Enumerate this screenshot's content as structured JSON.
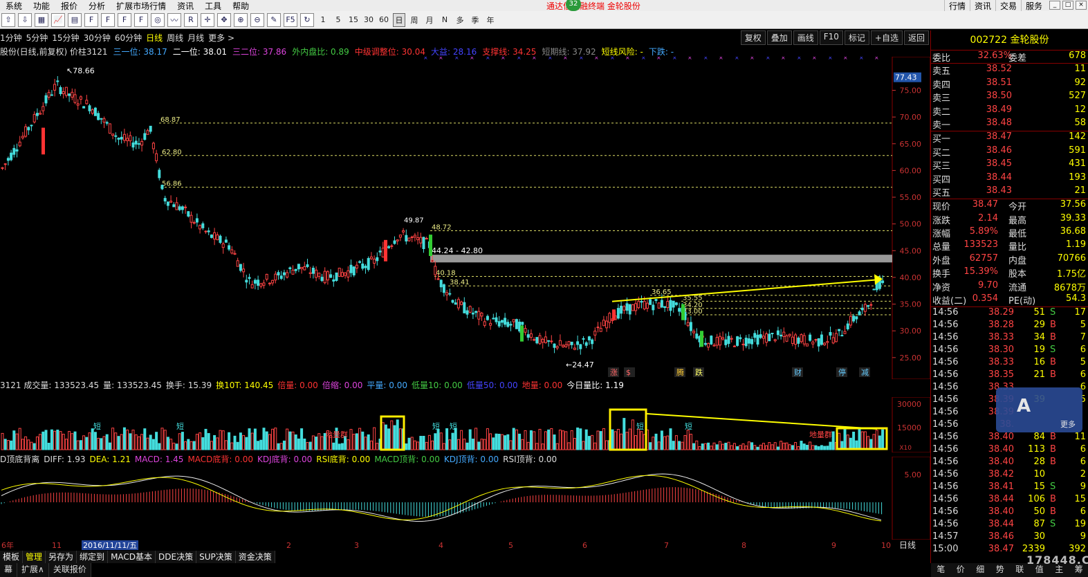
{
  "menubar": {
    "items": [
      "系统",
      "功能",
      "报价",
      "分析",
      "扩展市场行情",
      "资讯",
      "工具",
      "帮助"
    ],
    "title": "通达信金融终端",
    "stock": "金轮股份",
    "badge": "32",
    "right": [
      "行情",
      "资讯",
      "交易",
      "服务"
    ]
  },
  "toolbar": {
    "periods": [
      "1",
      "5",
      "15",
      "30",
      "60"
    ],
    "day_period": [
      "日",
      "周",
      "月",
      "N",
      "多",
      "季",
      "年"
    ]
  },
  "periodbar": {
    "items": [
      "1分钟",
      "5分钟",
      "15分钟",
      "30分钟",
      "60分钟",
      "日线",
      "周线",
      "月线",
      "更多 >"
    ],
    "active": "日线"
  },
  "rtools": [
    "复权",
    "叠加",
    "画线",
    "F10",
    "标记",
    "+自选",
    "返回"
  ],
  "info": [
    {
      "t": "股份(日线,前复权) 价柱3121",
      "c": "#ddd"
    },
    {
      "t": "三一位: 38.17",
      "c": "#4af"
    },
    {
      "t": "二一位: 38.01",
      "c": "#fff"
    },
    {
      "t": "三二位: 37.86",
      "c": "#d4d"
    },
    {
      "t": "外内盘比: 0.89",
      "c": "#4c4"
    },
    {
      "t": "中级调整位: 30.04",
      "c": "#f33"
    },
    {
      "t": "大益: 28.16",
      "c": "#44f"
    },
    {
      "t": "支撑线: 34.25",
      "c": "#f33"
    },
    {
      "t": "短期线: 37.92",
      "c": "#888"
    },
    {
      "t": "短线风险: -",
      "c": "#ff0"
    },
    {
      "t": "下跌: -",
      "c": "#4af"
    }
  ],
  "price_labels": {
    "high": "78.66",
    "low": "24.47",
    "l6887": "68.87",
    "l6280": "62.80",
    "l5686": "56.86",
    "l4987": "49.87",
    "l4872": "48.72",
    "band": "44.24 - 42.80",
    "l4018": "40.18",
    "l3841": "38.41",
    "l3665": "36.65",
    "l3555": "35.55",
    "l3420": "34.20",
    "l3300": "33.00",
    "current": "77.43"
  },
  "y_axis": [
    "75.00",
    "70.00",
    "65.00",
    "60.00",
    "55.00",
    "50.00",
    "45.00",
    "40.00",
    "35.00",
    "30.00",
    "25.00"
  ],
  "event_labels": [
    "涨",
    "$",
    "腾",
    "跌",
    "财",
    "停",
    "减"
  ],
  "volbar": [
    {
      "t": "3121 成交量: 133523.45",
      "c": "#ddd"
    },
    {
      "t": "量: 133523.45",
      "c": "#ddd"
    },
    {
      "t": "换手: 15.39",
      "c": "#ddd"
    },
    {
      "t": "换10T: 140.45",
      "c": "#ff0"
    },
    {
      "t": "倍量: 0.00",
      "c": "#f33"
    },
    {
      "t": "倍缩: 0.00",
      "c": "#d4d"
    },
    {
      "t": "平量: 0.00",
      "c": "#4af"
    },
    {
      "t": "低量10: 0.00",
      "c": "#4c4"
    },
    {
      "t": "低量50: 0.00",
      "c": "#44f"
    },
    {
      "t": "地量: 0.00",
      "c": "#f33"
    },
    {
      "t": "今日量比: 1.19",
      "c": "#fff"
    }
  ],
  "vol_axis": [
    "30000",
    "15000",
    "X10"
  ],
  "vol_labels": {
    "dl1": "地量群",
    "dl2": "地量群",
    "short": "短"
  },
  "macdbar": [
    {
      "t": "D顶底背离",
      "c": "#ddd"
    },
    {
      "t": "DIFF: 1.93",
      "c": "#ddd"
    },
    {
      "t": "DEA: 1.21",
      "c": "#ff0"
    },
    {
      "t": "MACD: 1.45",
      "c": "#d4d"
    },
    {
      "t": "MACD底背: 0.00",
      "c": "#f33"
    },
    {
      "t": "KDJ底背: 0.00",
      "c": "#d4d"
    },
    {
      "t": "RSI底背: 0.00",
      "c": "#ff0"
    },
    {
      "t": "MACD顶背: 0.00",
      "c": "#4c4"
    },
    {
      "t": "KDJ顶背: 0.00",
      "c": "#4af"
    },
    {
      "t": "RSI顶背: 0.00",
      "c": "#ddd"
    }
  ],
  "macd_axis": [
    "5.00"
  ],
  "x_axis": {
    "items": [
      "6年",
      "11",
      "2016/11/11/五",
      "2",
      "3",
      "4",
      "5",
      "6",
      "7",
      "8",
      "9",
      "10"
    ],
    "right": "日线"
  },
  "bottom_tabs": [
    "模板",
    "管理",
    "另存为",
    "绑定到",
    "MACD基本",
    "DDE决策",
    "SUP决策",
    "资金决策"
  ],
  "bottom_tabs2": [
    "幕",
    "扩展∧",
    "关联报价"
  ],
  "panel": {
    "code": "002722 金轮股份",
    "weibi": {
      "l": "委比",
      "v": "32.63%",
      "l2": "委差",
      "r": "678"
    },
    "sell": [
      {
        "l": "卖五",
        "p": "38.52",
        "q": "11"
      },
      {
        "l": "卖四",
        "p": "38.51",
        "q": "92"
      },
      {
        "l": "卖三",
        "p": "38.50",
        "q": "527"
      },
      {
        "l": "卖二",
        "p": "38.49",
        "q": "12"
      },
      {
        "l": "卖一",
        "p": "38.48",
        "q": "58"
      }
    ],
    "buy": [
      {
        "l": "买一",
        "p": "38.47",
        "q": "142"
      },
      {
        "l": "买二",
        "p": "38.46",
        "q": "591"
      },
      {
        "l": "买三",
        "p": "38.45",
        "q": "431"
      },
      {
        "l": "买四",
        "p": "38.44",
        "q": "193"
      },
      {
        "l": "买五",
        "p": "38.43",
        "q": "21"
      }
    ],
    "stats": [
      {
        "l": "现价",
        "v": "38.47",
        "l2": "今开",
        "r": "37.56"
      },
      {
        "l": "涨跌",
        "v": "2.14",
        "l2": "最高",
        "r": "39.33"
      },
      {
        "l": "涨幅",
        "v": "5.89%",
        "l2": "最低",
        "r": "36.68"
      },
      {
        "l": "总量",
        "v": "133523",
        "l2": "量比",
        "r": "1.19"
      },
      {
        "l": "外盘",
        "v": "62757",
        "l2": "内盘",
        "r": "70766"
      },
      {
        "l": "换手",
        "v": "15.39%",
        "l2": "股本",
        "r": "1.75亿"
      },
      {
        "l": "净资",
        "v": "9.70",
        "l2": "流通",
        "r": "8678万"
      },
      {
        "l": "收益(二)",
        "v": "0.354",
        "l2": "PE(动)",
        "r": "54.3"
      }
    ],
    "ticks": [
      {
        "t": "14:56",
        "p": "38.29",
        "q": "51",
        "s": "S",
        "n": "17"
      },
      {
        "t": "14:56",
        "p": "38.28",
        "q": "29",
        "s": "B",
        "n": "5"
      },
      {
        "t": "14:56",
        "p": "38.33",
        "q": "34",
        "s": "B",
        "n": "7"
      },
      {
        "t": "14:56",
        "p": "38.30",
        "q": "19",
        "s": "S",
        "n": "6"
      },
      {
        "t": "14:56",
        "p": "38.33",
        "q": "16",
        "s": "B",
        "n": "5"
      },
      {
        "t": "14:56",
        "p": "38.35",
        "q": "21",
        "s": "B",
        "n": "6"
      },
      {
        "t": "14:56",
        "p": "38.33",
        "q": "",
        "s": "",
        "n": "6"
      },
      {
        "t": "14:56",
        "p": "38.39",
        "q": "39",
        "s": "",
        "n": "5"
      },
      {
        "t": "14:56",
        "p": "38.39",
        "q": "",
        "s": "",
        "n": ""
      },
      {
        "t": "14:56",
        "p": "38.",
        "q": "",
        "s": "",
        "n": ""
      },
      {
        "t": "14:56",
        "p": "38.40",
        "q": "84",
        "s": "B",
        "n": "11"
      },
      {
        "t": "14:56",
        "p": "38.40",
        "q": "113",
        "s": "B",
        "n": "6"
      },
      {
        "t": "14:56",
        "p": "38.40",
        "q": "28",
        "s": "B",
        "n": "6"
      },
      {
        "t": "14:56",
        "p": "38.42",
        "q": "10",
        "s": "",
        "n": "2"
      },
      {
        "t": "14:56",
        "p": "38.41",
        "q": "15",
        "s": "S",
        "n": "9"
      },
      {
        "t": "14:56",
        "p": "38.44",
        "q": "106",
        "s": "B",
        "n": "15"
      },
      {
        "t": "14:56",
        "p": "38.40",
        "q": "50",
        "s": "B",
        "n": "6"
      },
      {
        "t": "14:56",
        "p": "38.44",
        "q": "87",
        "s": "S",
        "n": "19"
      },
      {
        "t": "14:57",
        "p": "38.46",
        "q": "30",
        "s": "",
        "n": "9"
      },
      {
        "t": "15:00",
        "p": "38.47",
        "q": "2339",
        "s": "",
        "n": "392"
      }
    ],
    "bottom": [
      "笔",
      "价",
      "细",
      "势",
      "联",
      "值",
      "主",
      "筹"
    ]
  },
  "watermark": {
    "text": "更多",
    "site": "178448.COM"
  },
  "colors": {
    "up": "#ff3333",
    "down": "#33dddd",
    "yellow": "#ffff00",
    "grid": "#550000"
  }
}
